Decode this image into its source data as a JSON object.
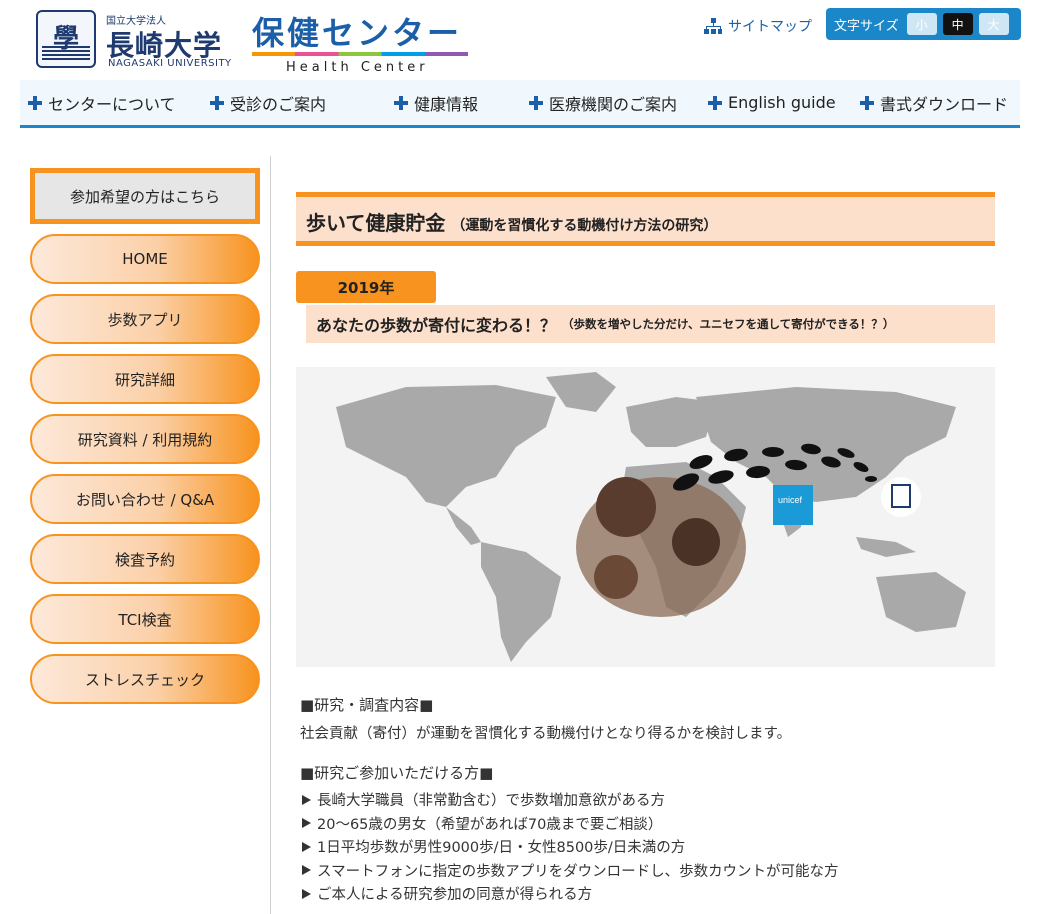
{
  "header": {
    "univ_small": "国立大学法人",
    "univ_name": "長崎大学",
    "univ_en": "NAGASAKI UNIVERSITY",
    "center_jp": "保健センター",
    "center_en": "Health Center",
    "sitemap": "サイトマップ",
    "fontsize_label": "文字サイズ",
    "fontsize_options": [
      "小",
      "中",
      "大"
    ],
    "fontsize_selected": "中"
  },
  "nav": [
    "センターについて",
    "受診のご案内",
    "健康情報",
    "医療機関のご案内",
    "English guide",
    "書式ダウンロード"
  ],
  "sidebar": {
    "join": "参加希望の方はこちら",
    "items": [
      "HOME",
      "歩数アプリ",
      "研究詳細",
      "研究資料 / 利用規約",
      "お問い合わせ / Q&A",
      "検査予約",
      "TCI検査",
      "ストレスチェック"
    ]
  },
  "main": {
    "title": "歩いて健康貯金",
    "title_sub": "（運動を習慣化する動機付け方法の研究）",
    "year": "2019年",
    "headline": "あなたの歩数が寄付に変わる！？",
    "headline_note": "（歩数を増やした分だけ、ユニセフを通して寄付ができる！？）",
    "map_unicef": "unicef",
    "section1_title": "■研究・調査内容■",
    "section1_body": "社会貢献（寄付）が運動を習慣化する動機付けとなり得るかを検討します。",
    "section2_title": "■研究ご参加いただける方■",
    "section2_items": [
      "長崎大学職員（非常勤含む）で歩数増加意欲がある方",
      "20～65歳の男女（希望があれば70歳まで要ご相談）",
      "1日平均歩数が男性9000歩/日・女性8500歩/日未満の方",
      "スマートフォンに指定の歩数アプリをダウンロードし、歩数カウントが可能な方",
      "ご本人による研究参加の同意が得られる方"
    ]
  },
  "colors": {
    "accent_orange": "#f7931e",
    "brand_blue": "#1b5fa8",
    "peach": "#fde0cc"
  }
}
